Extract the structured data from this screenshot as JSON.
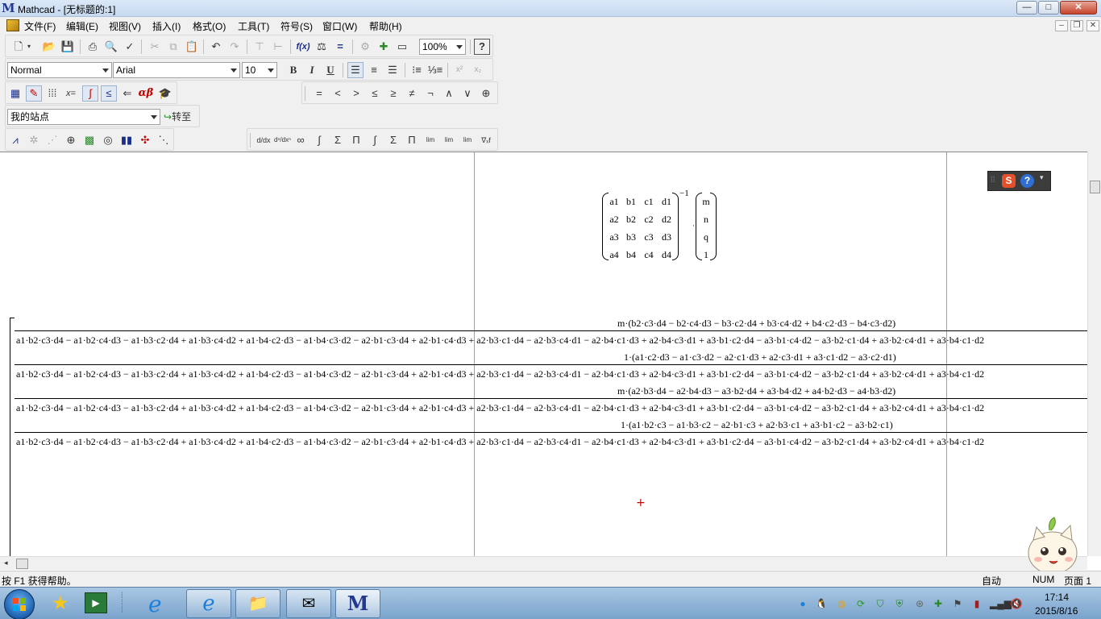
{
  "window": {
    "title": "Mathcad - [无标题的:1]",
    "logo": "M"
  },
  "window_controls": {
    "minimize": "—",
    "maximize": "□",
    "close": "✕"
  },
  "menu": {
    "items": [
      "文件(F)",
      "编辑(E)",
      "视图(V)",
      "插入(I)",
      "格式(O)",
      "工具(T)",
      "符号(S)",
      "窗口(W)",
      "帮助(H)"
    ],
    "mdi_controls": [
      "–",
      "❐",
      "✕"
    ]
  },
  "toolbar_standard": {
    "zoom": "100%",
    "help": "?"
  },
  "toolbar_formatting": {
    "style": "Normal",
    "font": "Arial",
    "size": "10",
    "bold": "B",
    "italic": "I",
    "underline": "U"
  },
  "toolbar_math": {
    "xeq": "x=",
    "greek": "αβ"
  },
  "toolbar_boolean": {
    "symbols": [
      "=",
      "<",
      ">",
      "≤",
      "≥",
      "≠",
      "¬",
      "∧",
      "∨",
      "⊕"
    ]
  },
  "toolbar_web": {
    "site": "我的站点",
    "go": "转至"
  },
  "toolbar_calculus": {
    "symbols": [
      "d/dx",
      "dⁿ/dxⁿ",
      "∞",
      "∫",
      "Σ",
      "Π",
      "∫",
      "Σ",
      "Π",
      "lim",
      "lim",
      "lim",
      "∇ₓf"
    ]
  },
  "worksheet": {
    "inverse_exponent": "−1",
    "matrix": [
      [
        "a1",
        "b1",
        "c1",
        "d1"
      ],
      [
        "a2",
        "b2",
        "c2",
        "d2"
      ],
      [
        "a3",
        "b3",
        "c3",
        "d3"
      ],
      [
        "a4",
        "b4",
        "c4",
        "d4"
      ]
    ],
    "vector": [
      "m",
      "n",
      "q",
      "1"
    ],
    "fractions": [
      {
        "numerator": "m·(b2·c3·d4 − b2·c4·d3 − b3·c2·d4 + b3·c4·d2 + b4·c2·d3 − b4·c3·d2)"
      },
      {
        "numerator": "1·(a1·c2·d3 − a1·c3·d2 − a2·c1·d3 + a2·c3·d1 + a3·c1·d2 − a3·c2·d1)"
      },
      {
        "numerator": "m·(a2·b3·d4 − a2·b4·d3 − a3·b2·d4 + a3·b4·d2 + a4·b2·d3 − a4·b3·d2)"
      },
      {
        "numerator": "1·(a1·b2·c3 − a1·b3·c2 − a2·b1·c3 + a2·b3·c1 + a3·b1·c2 − a3·b2·c1)"
      }
    ],
    "denominator": "a1·b2·c3·d4 − a1·b2·c4·d3 − a1·b3·c2·d4 + a1·b3·c4·d2 + a1·b4·c2·d3 − a1·b4·c3·d2 − a2·b1·c3·d4 + a2·b1·c4·d3 + a2·b3·c1·d4 − a2·b3·c4·d1 − a2·b4·c1·d3 + a2·b4·c3·d1 + a3·b1·c2·d4 − a3·b1·c4·d2 − a3·b2·c1·d4 + a3·b2·c4·d1 + a3·b4·c1·d2",
    "cursor": "+"
  },
  "status": {
    "help": "按 F1 获得帮助。",
    "mode": "自动",
    "num": "NUM",
    "page": "页面 1"
  },
  "taskbar": {
    "time": "17:14",
    "date": "2015/8/16"
  },
  "colors": {
    "cursor": "#c00000",
    "titlebar": "#c6d9f0",
    "taskbar": "#7aa3cb"
  }
}
